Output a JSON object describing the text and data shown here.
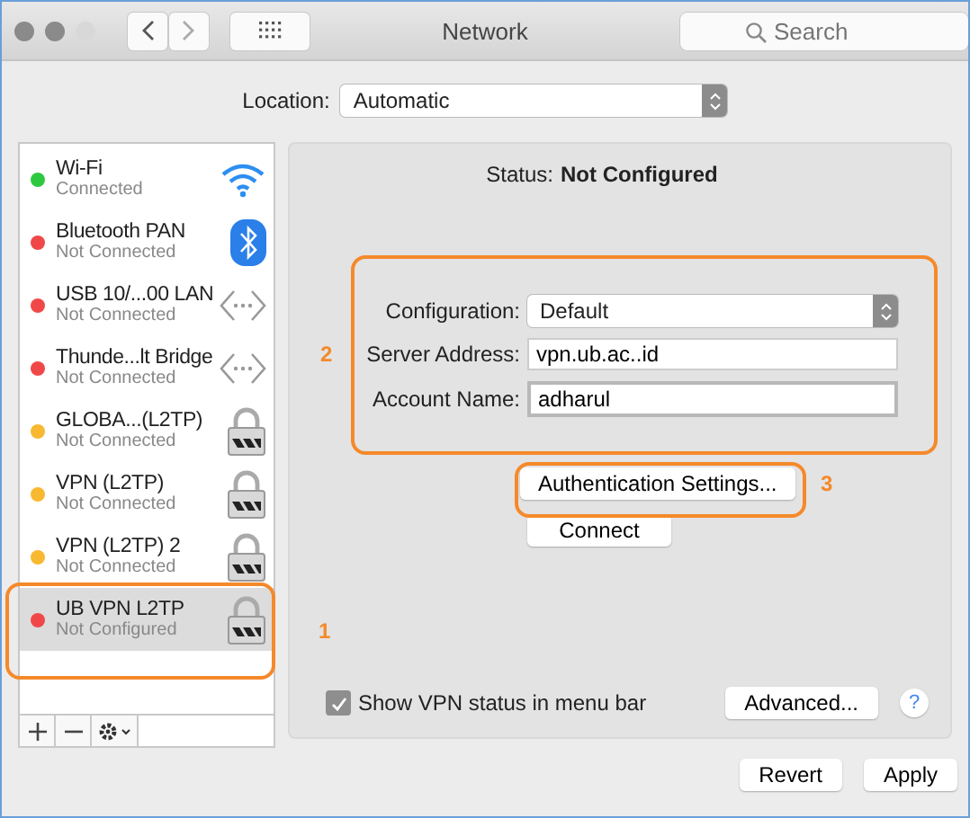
{
  "window": {
    "title": "Network"
  },
  "search": {
    "placeholder": "Search"
  },
  "location": {
    "label": "Location:",
    "value": "Automatic"
  },
  "services": [
    {
      "name": "Wi-Fi",
      "status": "Connected",
      "color": "#2ec840",
      "kind": "wifi",
      "selected": false
    },
    {
      "name": "Bluetooth PAN",
      "status": "Not Connected",
      "color": "#f04848",
      "kind": "bluetooth",
      "selected": false
    },
    {
      "name": "USB 10/...00 LAN",
      "status": "Not Connected",
      "color": "#f04848",
      "kind": "ethernet",
      "selected": false
    },
    {
      "name": "Thunde...lt Bridge",
      "status": "Not Connected",
      "color": "#f04848",
      "kind": "ethernet",
      "selected": false
    },
    {
      "name": "GLOBA...(L2TP)",
      "status": "Not Connected",
      "color": "#f8b830",
      "kind": "lock",
      "selected": false
    },
    {
      "name": "VPN (L2TP)",
      "status": "Not Connected",
      "color": "#f8b830",
      "kind": "lock",
      "selected": false
    },
    {
      "name": "VPN (L2TP) 2",
      "status": "Not Connected",
      "color": "#f8b830",
      "kind": "lock",
      "selected": false
    },
    {
      "name": "UB VPN L2TP",
      "status": "Not Configured",
      "color": "#f04848",
      "kind": "lock",
      "selected": true
    }
  ],
  "status": {
    "label": "Status:",
    "value": "Not Configured"
  },
  "configuration": {
    "label": "Configuration:",
    "value": "Default"
  },
  "server_address": {
    "label": "Server Address:",
    "value": "vpn.ub.ac..id"
  },
  "account_name": {
    "label": "Account Name:",
    "value": "adharul"
  },
  "auth_button": "Authentication Settings...",
  "connect_button": "Connect",
  "show_vpn_status": {
    "label": "Show VPN status in menu bar",
    "checked": true
  },
  "advanced_button": "Advanced...",
  "help": "?",
  "revert_button": "Revert",
  "apply_button": "Apply",
  "annotations": [
    {
      "label": "1"
    },
    {
      "label": "2"
    },
    {
      "label": "3"
    }
  ]
}
